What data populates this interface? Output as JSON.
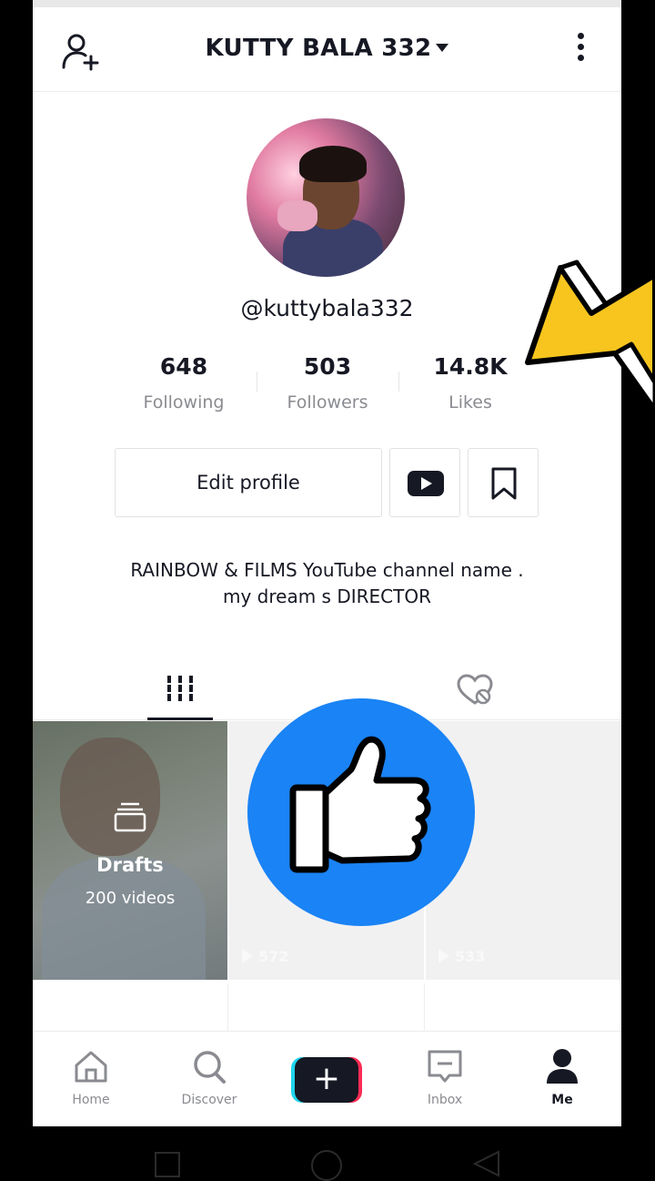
{
  "header": {
    "username_title": "KUTTY BALA 332",
    "add_user_icon": "add-user-icon",
    "more_icon": "more-vertical-icon"
  },
  "profile": {
    "handle": "@kuttybala332",
    "stats": [
      {
        "value": "648",
        "label": "Following"
      },
      {
        "value": "503",
        "label": "Followers"
      },
      {
        "value": "14.8K",
        "label": "Likes"
      }
    ],
    "edit_profile_label": "Edit profile",
    "bio_line1": "RAINBOW & FILMS YouTube channel name .",
    "bio_line2": "my dream s DIRECTOR"
  },
  "videos": {
    "drafts_label": "Drafts",
    "drafts_count": "200 videos",
    "items": [
      {
        "views": "572"
      },
      {
        "views": "533"
      }
    ]
  },
  "nav": {
    "home": "Home",
    "discover": "Discover",
    "inbox": "Inbox",
    "me": "Me",
    "create": "+"
  },
  "colors": {
    "accent_blue": "#1a83f5",
    "arrow_yellow": "#f7c51e",
    "text_dark": "#161823",
    "text_gray": "#8a8b91"
  }
}
